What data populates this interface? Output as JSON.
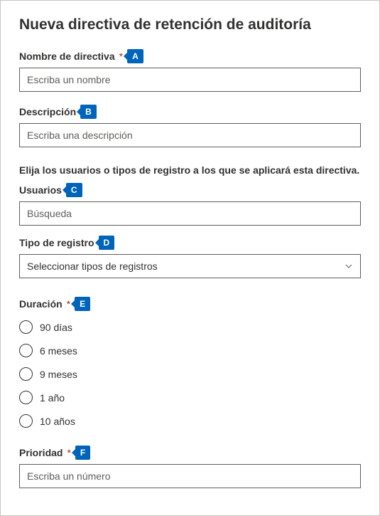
{
  "title": "Nueva directiva de retención de auditoría",
  "fields": {
    "name": {
      "label": "Nombre de directiva",
      "required": true,
      "badge": "A",
      "placeholder": "Escriba un nombre",
      "value": ""
    },
    "description": {
      "label": "Descripción",
      "required": false,
      "badge": "B",
      "placeholder": "Escriba una descripción",
      "value": ""
    }
  },
  "section_text": "Elija los usuarios o tipos de registro a los que se aplicará esta directiva.",
  "users": {
    "label": "Usuarios",
    "required": false,
    "badge": "C",
    "placeholder": "Búsqueda",
    "value": ""
  },
  "record_type": {
    "label": "Tipo de registro",
    "required": false,
    "badge": "D",
    "selected": "Seleccionar tipos de registros"
  },
  "duration": {
    "label": "Duración",
    "required": true,
    "badge": "E",
    "options": [
      "90 días",
      "6 meses",
      "9 meses",
      "1 año",
      "10 años"
    ]
  },
  "priority": {
    "label": "Prioridad",
    "required": true,
    "badge": "F",
    "placeholder": "Escriba un número",
    "value": ""
  }
}
